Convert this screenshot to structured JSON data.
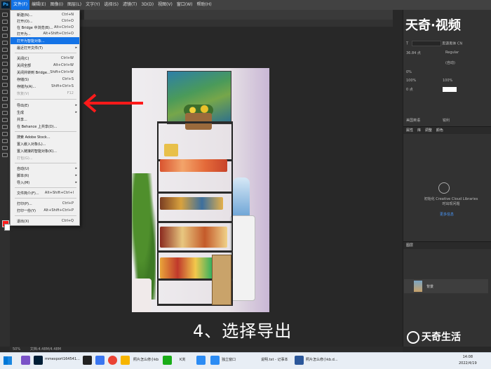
{
  "menubar": {
    "logo": "Ps",
    "items": [
      "文件(F)",
      "编辑(E)",
      "图像(I)",
      "图层(L)",
      "文字(Y)",
      "选择(S)",
      "滤镜(T)",
      "3D(D)",
      "视图(V)",
      "窗口(W)",
      "帮助(H)"
    ]
  },
  "file_menu": {
    "items": [
      {
        "label": "新建(N)...",
        "shortcut": "Ctrl+N"
      },
      {
        "label": "打开(O)...",
        "shortcut": "Ctrl+O"
      },
      {
        "label": "在 Bridge 中浏览(B)...",
        "shortcut": "Alt+Ctrl+O"
      },
      {
        "label": "打开为...",
        "shortcut": "Alt+Shift+Ctrl+O"
      },
      {
        "label": "打开为智能对象...",
        "shortcut": ""
      },
      {
        "label": "最近打开文件(T)",
        "shortcut": ""
      },
      {
        "label": "关闭(C)",
        "shortcut": "Ctrl+W"
      },
      {
        "label": "关闭全部",
        "shortcut": "Alt+Ctrl+W"
      },
      {
        "label": "关闭并转到 Bridge...",
        "shortcut": "Shift+Ctrl+W"
      },
      {
        "label": "存储(S)",
        "shortcut": "Ctrl+S"
      },
      {
        "label": "存储为(A)...",
        "shortcut": "Shift+Ctrl+S"
      },
      {
        "label": "恢复(V)",
        "shortcut": "F12"
      },
      {
        "label": "导出(E)",
        "shortcut": ""
      },
      {
        "label": "生成",
        "shortcut": ""
      },
      {
        "label": "共享...",
        "shortcut": ""
      },
      {
        "label": "在 Behance 上共享(D)...",
        "shortcut": ""
      },
      {
        "label": "搜索 Adobe Stock...",
        "shortcut": ""
      },
      {
        "label": "置入嵌入对象(L)...",
        "shortcut": ""
      },
      {
        "label": "置入链接的智能对象(K)...",
        "shortcut": ""
      },
      {
        "label": "打包(G)...",
        "shortcut": ""
      },
      {
        "label": "自动(U)",
        "shortcut": ""
      },
      {
        "label": "脚本(R)",
        "shortcut": ""
      },
      {
        "label": "导入(M)",
        "shortcut": ""
      },
      {
        "label": "文件简介(F)...",
        "shortcut": "Alt+Shift+Ctrl+I"
      },
      {
        "label": "打印(P)...",
        "shortcut": "Ctrl+P"
      },
      {
        "label": "打印一份(Y)",
        "shortcut": "Alt+Shift+Ctrl+P"
      },
      {
        "label": "退出(X)",
        "shortcut": "Ctrl+Q"
      }
    ]
  },
  "caption": "4、选择导出",
  "watermark_top": "天奇·视频",
  "watermark_bottom": "天奇生活",
  "character_panel": {
    "font_name": "思源黑体 CN",
    "font_style": "Regular",
    "font_size": "36.84 点",
    "leading": "(自动)",
    "tracking": "0%",
    "scale_v": "100%",
    "scale_h": "100%",
    "baseline": "0 点",
    "language": "美国英语",
    "antialias": "锐利"
  },
  "panels": {
    "libraries_tab1": "属性",
    "libraries_tab2": "库",
    "libraries_tab3": "调整",
    "libraries_tab4": "颜色",
    "cc_text": "初始化 Creative Cloud Libraries 时出现问题",
    "cc_link": "更多信息",
    "layers_header": "图层",
    "layer_name": "背景"
  },
  "status": {
    "zoom": "50%",
    "doc": "文档:4.48M/4.48M"
  },
  "taskbar": {
    "items": [
      "mmexport164541...",
      "照片怎么修小kb",
      "K浏",
      "独立窗口",
      "说明.txt - 记事本",
      "照片怎么修小kb.d..."
    ],
    "time": "14:08",
    "date": "2022/4/19"
  },
  "colors": {
    "accent": "#1473e6",
    "arrow": "#ff1a1a"
  }
}
